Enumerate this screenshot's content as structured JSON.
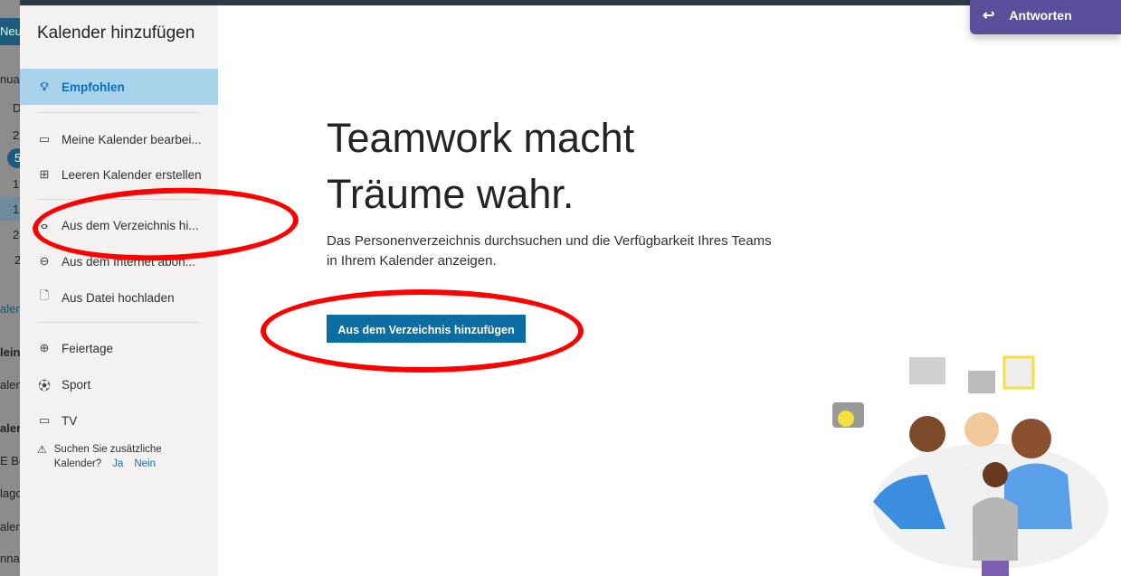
{
  "background": {
    "new_button": "Neu",
    "fragments": [
      "nua",
      "D",
      "2",
      "5",
      "1",
      "1",
      "2",
      "2",
      "alen",
      "lein",
      "alen",
      "alen",
      "E Be",
      "lago",
      "alen",
      "nna"
    ]
  },
  "dialog": {
    "title": "Kalender hinzufügen",
    "nav": [
      {
        "label": "Empfohlen",
        "icon": "lightbulb-icon",
        "selected": true
      },
      {
        "label": "Meine Kalender bearbei...",
        "icon": "edit-calendar-icon"
      },
      {
        "label": "Leeren Kalender erstellen",
        "icon": "add-calendar-icon"
      },
      {
        "label": "Aus dem Verzeichnis hi...",
        "icon": "people-icon"
      },
      {
        "label": "Aus dem Internet abon...",
        "icon": "link-icon"
      },
      {
        "label": "Aus Datei hochladen",
        "icon": "upload-file-icon"
      },
      {
        "label": "Feiertage",
        "icon": "globe-icon"
      },
      {
        "label": "Sport",
        "icon": "ball-icon"
      },
      {
        "label": "TV",
        "icon": "tv-icon"
      }
    ],
    "feedback": {
      "text": "Suchen Sie zusätzliche Kalender?",
      "yes": "Ja",
      "no": "Nein"
    },
    "main": {
      "title_line1": "Teamwork macht",
      "title_line2": "Träume wahr.",
      "description": "Das Personenverzeichnis durchsuchen und die Verfügbarkeit Ihres Teams in Ihrem Kalender anzeigen.",
      "button": "Aus dem Verzeichnis hinzufügen"
    }
  },
  "reply": {
    "label": "Antworten",
    "icon": "reply-icon"
  },
  "annotation_color": "#ff0000"
}
